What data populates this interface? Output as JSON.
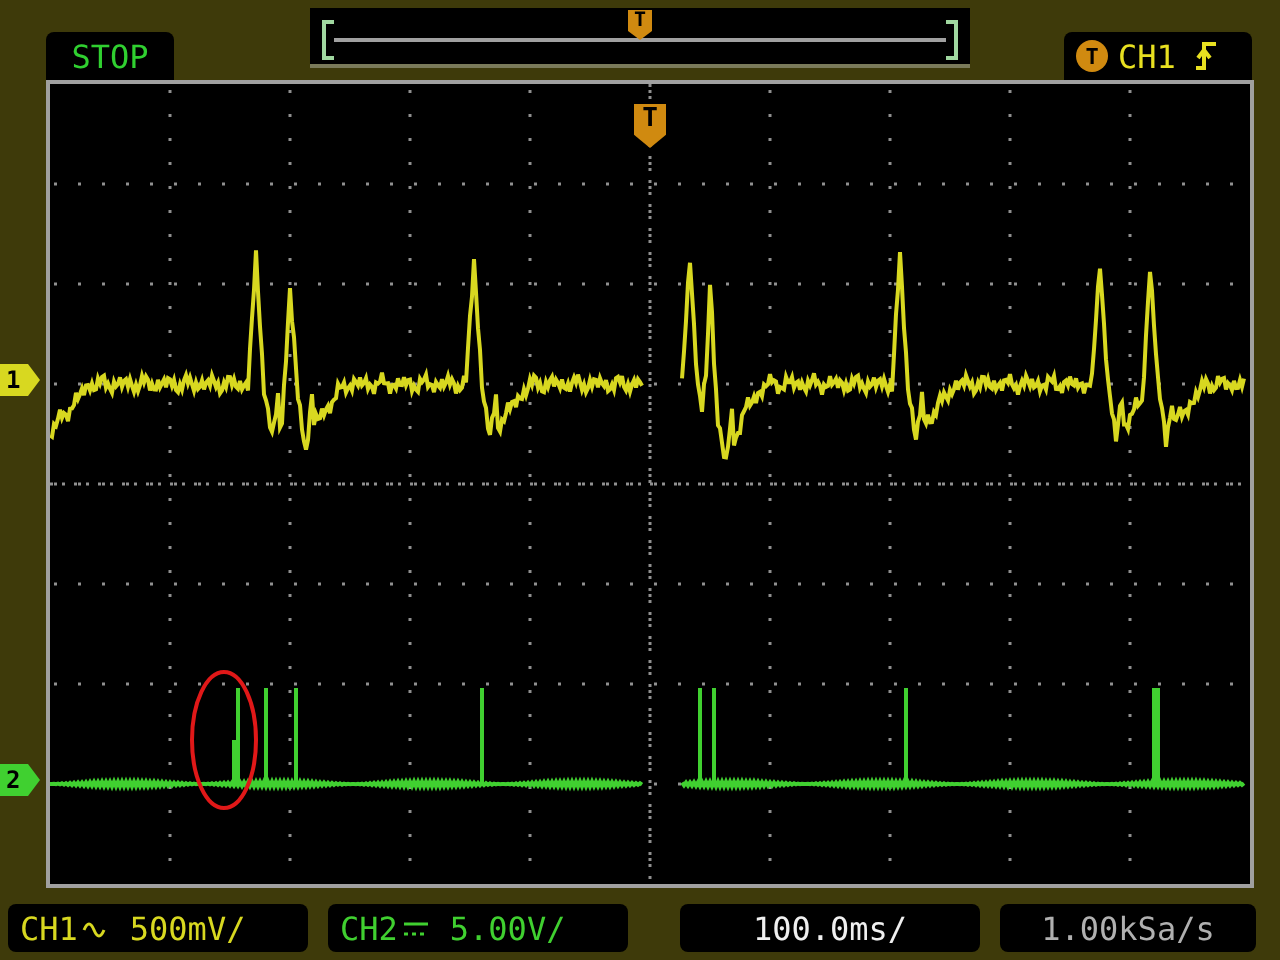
{
  "run_state": "STOP",
  "position_bar": {
    "marker": "T"
  },
  "trigger": {
    "marker": "T",
    "source": "CH1",
    "kind": "rising"
  },
  "screen": {
    "trigger_marker": "T",
    "channels": [
      {
        "label": "1",
        "color": "#d8d820"
      },
      {
        "label": "2",
        "color": "#40d030"
      }
    ]
  },
  "status_bar": {
    "channels": [
      {
        "name": "CH1",
        "kind": "ac",
        "scale": "500mV/",
        "color": "#d8d820"
      },
      {
        "name": "CH2",
        "kind": "dc",
        "scale": "5.00V/",
        "color": "#40d030"
      }
    ],
    "timebase": "100.0ms/",
    "sample_rate": "1.00kSa/s"
  }
}
